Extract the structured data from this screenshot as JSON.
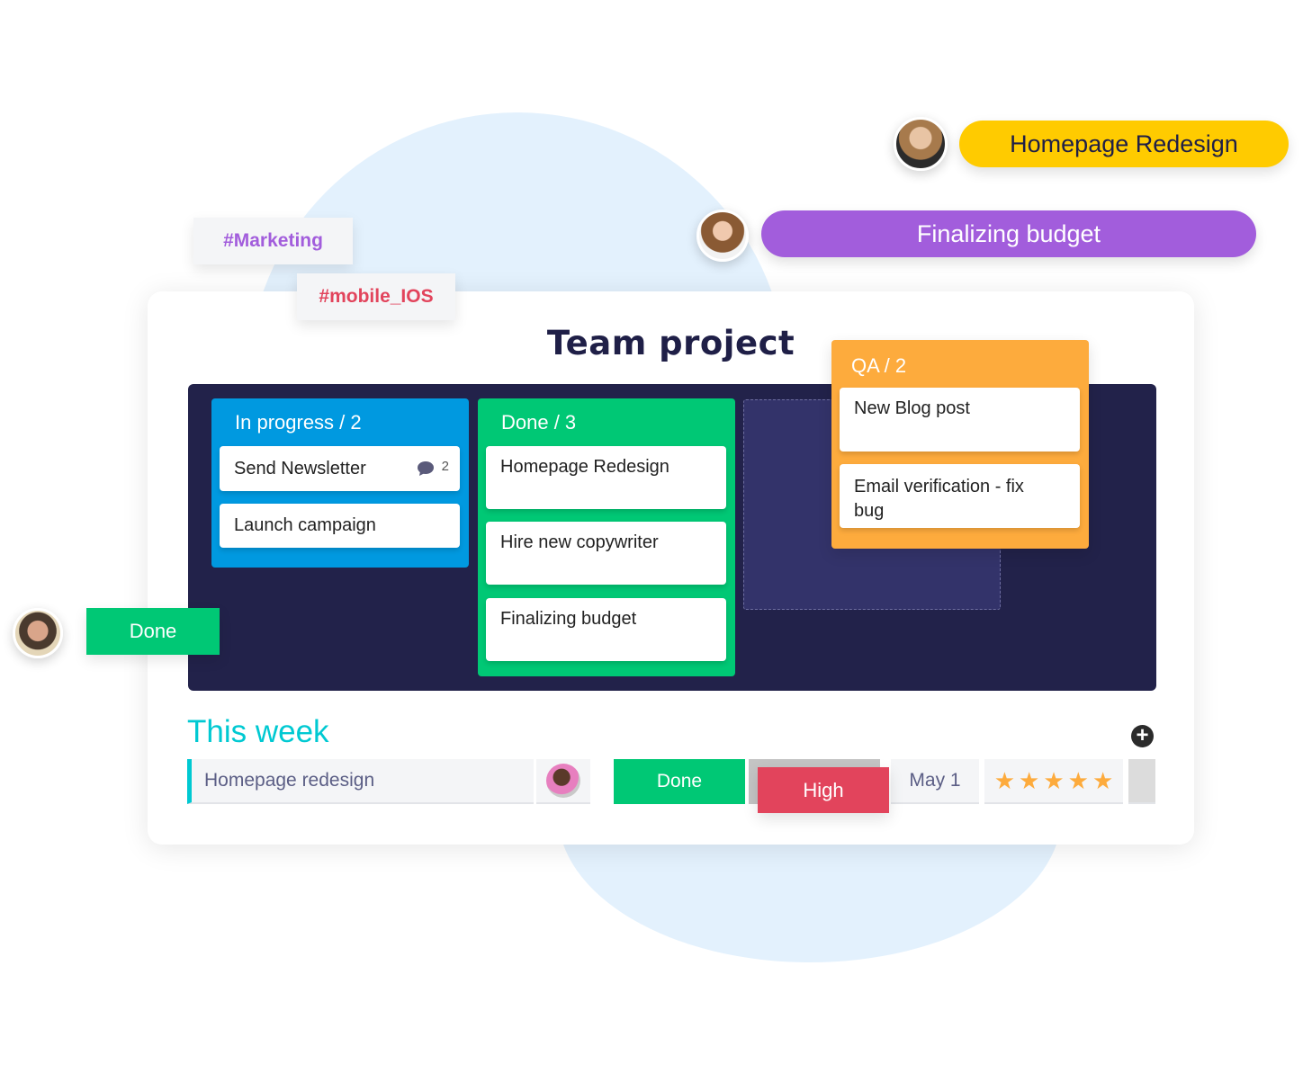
{
  "floating": {
    "pill_homepage": {
      "label": "Homepage Redesign",
      "color": "#ffcb00"
    },
    "pill_budget": {
      "label": "Finalizing budget",
      "color": "#a25ddc"
    },
    "tag_marketing": {
      "label": "#Marketing",
      "color": "#a25ddc"
    },
    "tag_mobile": {
      "label": "#mobile_IOS",
      "color": "#e2445c"
    },
    "done_badge": {
      "label": "Done",
      "color": "#00c875"
    }
  },
  "board": {
    "title": "Team project",
    "columns": [
      {
        "header": "In progress / 2",
        "color": "#0099e0",
        "cards": [
          {
            "text": "Send Newsletter",
            "comments": "2"
          },
          {
            "text": "Launch campaign"
          }
        ]
      },
      {
        "header": "Done / 3",
        "color": "#00c875",
        "cards": [
          {
            "text": "Homepage Redesign"
          },
          {
            "text": "Hire new copywriter"
          },
          {
            "text": "Finalizing budget"
          }
        ]
      },
      {
        "header": "QA / 2",
        "color": "#fdab3d",
        "cards": [
          {
            "text": "New Blog post"
          },
          {
            "text": "Email verification - fix bug"
          }
        ]
      }
    ]
  },
  "week": {
    "title": "This week",
    "row": {
      "name": "Homepage redesign",
      "status": "Done",
      "priority": "High",
      "date": "May 1",
      "rating": 5,
      "rating_max": 5
    }
  }
}
